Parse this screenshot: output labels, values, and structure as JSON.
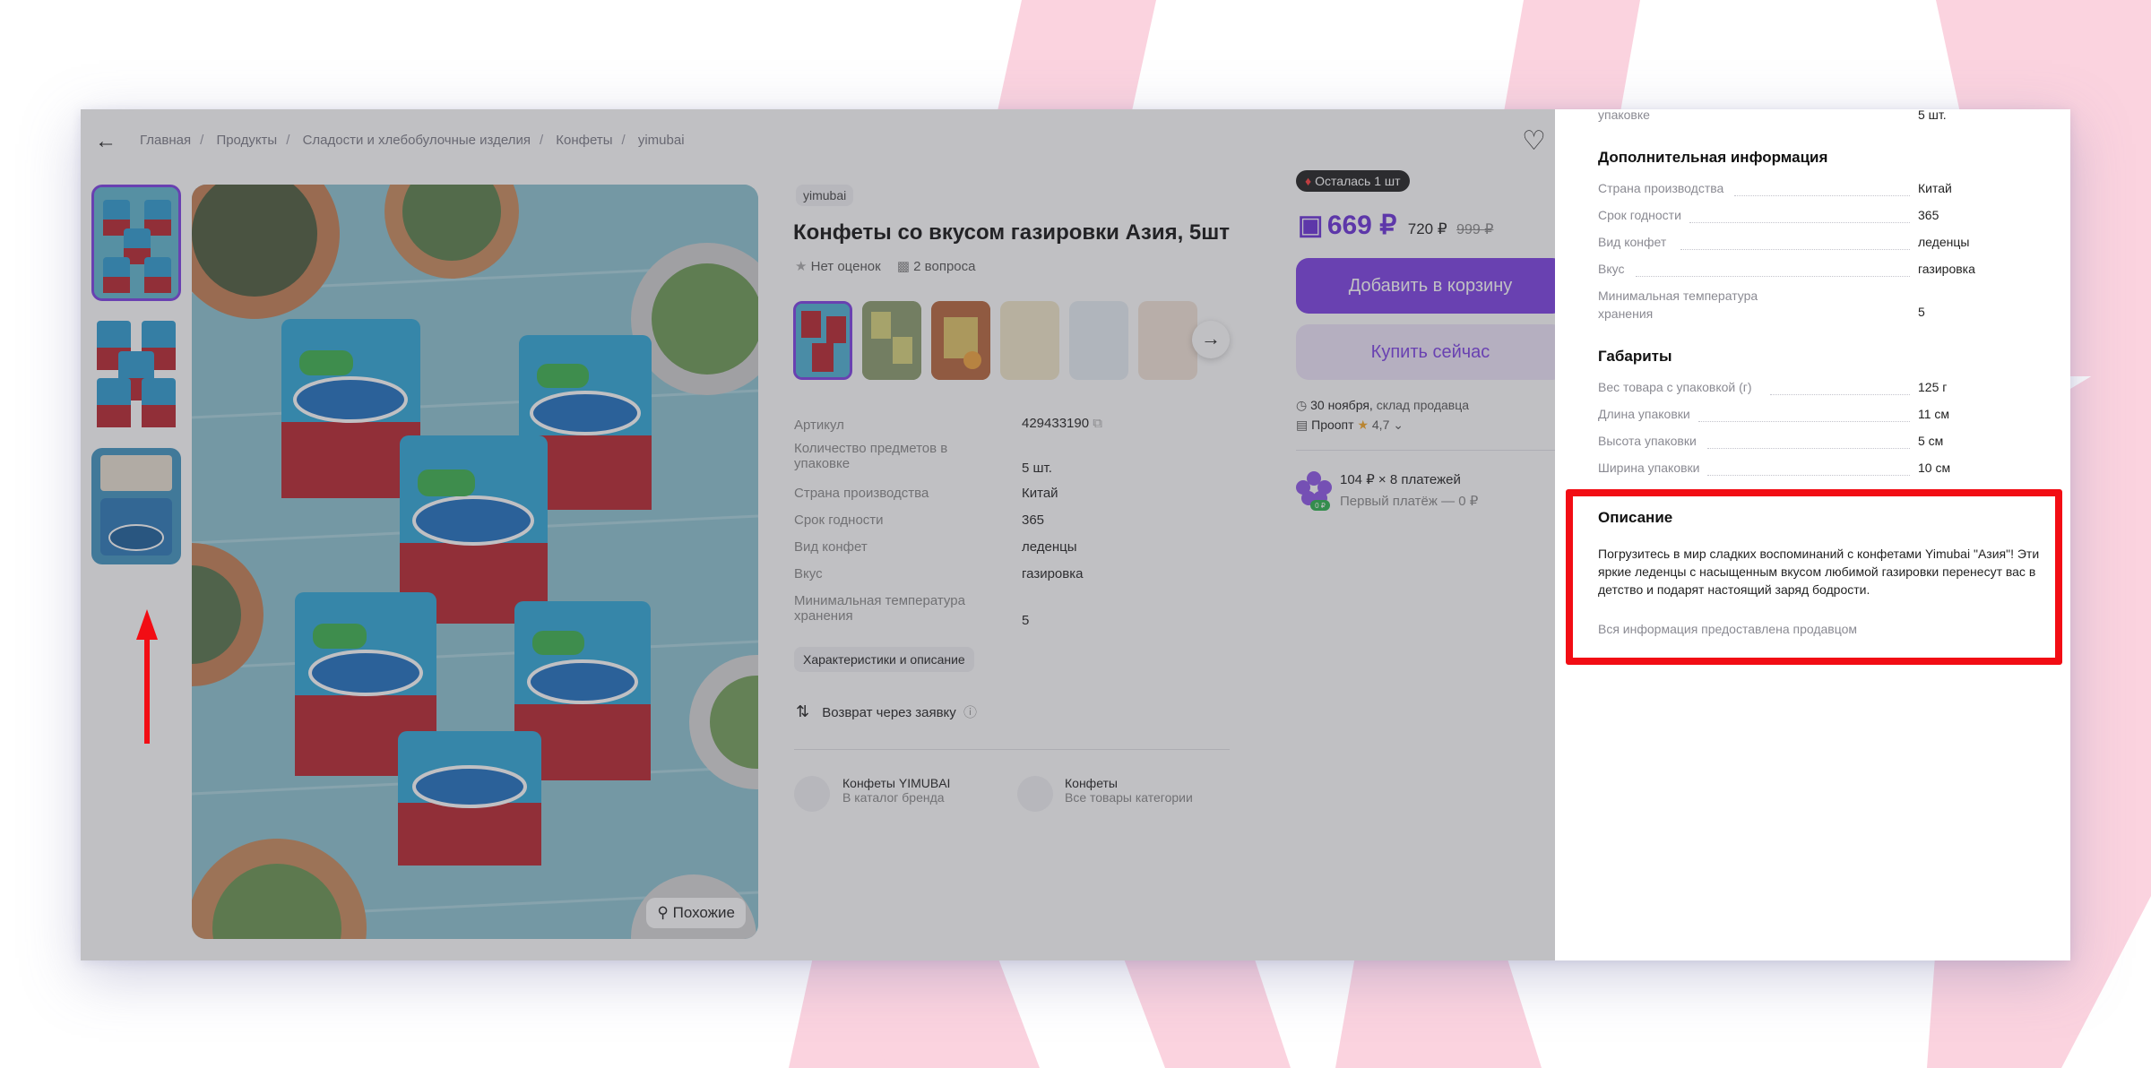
{
  "breadcrumbs": [
    "Главная",
    "Продукты",
    "Сладости и хлебобулочные изделия",
    "Конфеты",
    "yimubai"
  ],
  "product": {
    "brand": "yimubai",
    "title": "Конфеты со вкусом газировки Азия, 5шт",
    "rating_text": "Нет оценок",
    "questions_text": "2 вопроса",
    "similar_label": "Похожие"
  },
  "specs": [
    {
      "label": "Артикул",
      "value": "429433190"
    },
    {
      "label": "Количество предметов в упаковке",
      "value": "5 шт."
    },
    {
      "label": "Страна производства",
      "value": "Китай"
    },
    {
      "label": "Срок годности",
      "value": "365"
    },
    {
      "label": "Вид конфет",
      "value": "леденцы"
    },
    {
      "label": "Вкус",
      "value": "газировка"
    },
    {
      "label": "Минимальная температура хранения",
      "value": "5"
    }
  ],
  "characteristics_button": "Характеристики и описание",
  "return_text": "Возврат через заявку",
  "links": [
    {
      "title": "Конфеты YIMUBAI",
      "sub": "В каталог бренда"
    },
    {
      "title": "Конфеты",
      "sub": "Все товары категории"
    }
  ],
  "buybox": {
    "stock_badge": "Осталась 1 шт",
    "price": "669 ₽",
    "price_no_card": "720 ₽",
    "price_old": "999 ₽",
    "add_to_cart": "Добавить в корзину",
    "buy_now": "Купить сейчас",
    "delivery_date": "30 ноября,",
    "delivery_source": "склад продавца",
    "seller_name": "Проопт",
    "seller_rating": "4,7",
    "installment": "104 ₽ × 8 платежей",
    "installment_sub": "Первый платёж — 0 ₽",
    "installment_badge": "0 ₽"
  },
  "drawer": {
    "top_cut_label": "упаковке",
    "top_cut_value": "5 шт.",
    "sections": [
      {
        "title": "Дополнительная информация",
        "rows": [
          {
            "label": "Страна производства",
            "value": "Китай"
          },
          {
            "label": "Срок годности",
            "value": "365"
          },
          {
            "label": "Вид конфет",
            "value": "леденцы"
          },
          {
            "label": "Вкус",
            "value": "газировка"
          },
          {
            "label": "Минимальная температура хранения",
            "value": "5"
          }
        ]
      },
      {
        "title": "Габариты",
        "rows": [
          {
            "label": "Вес товара с упаковкой (г)",
            "value": "125 г"
          },
          {
            "label": "Длина упаковки",
            "value": "11 см"
          },
          {
            "label": "Высота упаковки",
            "value": "5 см"
          },
          {
            "label": "Ширина упаковки",
            "value": "10 см"
          }
        ]
      }
    ],
    "description_title": "Описание",
    "description": "Погрузитесь в мир сладких воспоминаний с конфетами Yimubai \"Азия\"! Эти яркие леденцы с насыщенным вкусом любимой газировки перенесут вас в детство и подарят настоящий заряд бодрости.",
    "description_note": "Вся информация предоставлена продавцом"
  },
  "colors": {
    "accent": "#7b3fe4",
    "highlight": "#f20d14",
    "stripes": "#fbd3df"
  }
}
